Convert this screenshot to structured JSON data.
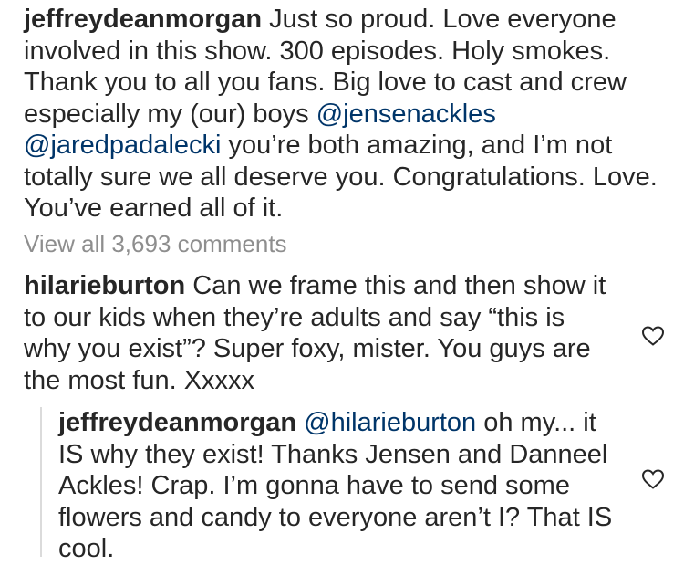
{
  "post": {
    "author": "jeffreydeanmorgan",
    "caption_part1": " Just so proud. Love everyone involved in this show. 300 episodes. Holy smokes. Thank you to all you fans. Big love to cast and crew especially my (our) boys ",
    "mention1": "@jensenackles",
    "caption_part2": " ",
    "mention2": "@jaredpadalecki",
    "caption_part3": " you’re both amazing, and I’m not totally sure we all deserve you. Congratulations. Love. You’ve earned all of it."
  },
  "comments_link": "View all 3,693 comments",
  "comment": {
    "author": "hilarieburton",
    "text": " Can we frame this and then show it to our kids when they’re  adults and say “this is why you exist”? Super foxy, mister. You guys are the most fun. Xxxxx"
  },
  "reply": {
    "author": "jeffreydeanmorgan",
    "text_prefix": " ",
    "mention": "@hilarieburton",
    "text": " oh my... it IS why they exist! Thanks Jensen and Danneel Ackles! Crap. I’m gonna have to send some flowers and candy to everyone aren’t I? That IS cool."
  },
  "icons": {
    "like_comment": "heart-outline-icon",
    "like_reply": "heart-outline-icon"
  },
  "colors": {
    "text": "#262626",
    "mention": "#003569",
    "muted": "#8e8e8e",
    "thread_line": "#dbdbdb"
  }
}
